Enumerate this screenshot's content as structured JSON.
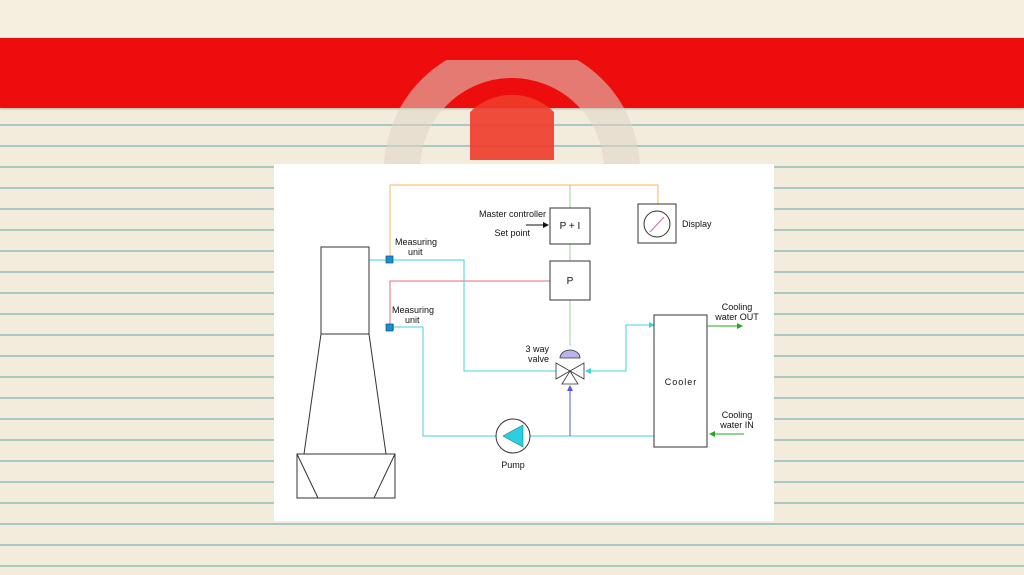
{
  "diagram": {
    "labels": {
      "measuring_unit_top_1": "Measuring",
      "measuring_unit_top_2": "unit",
      "measuring_unit_bottom_1": "Measuring",
      "measuring_unit_bottom_2": "unit",
      "master_controller": "Master controller",
      "set_point": "Set point",
      "pi_controller": "P + I",
      "p_controller": "P",
      "display": "Display",
      "valve_1": "3 way",
      "valve_2": "valve",
      "cooler": "Cooler",
      "cooling_out_1": "Cooling",
      "cooling_out_2": "water OUT",
      "cooling_in_1": "Cooling",
      "cooling_in_2": "water IN",
      "pump": "Pump"
    },
    "colors": {
      "water_line": "#3fd3e0",
      "signal_orange": "#f0b860",
      "signal_red": "#e07070",
      "signal_green": "#9ed09e",
      "cooling_water": "#22aa22",
      "bypass_blue": "#5555dd",
      "sensor": "#1a8fcf",
      "pump_fill": "#2ad0e0",
      "valve_fill": "#b9b2ee",
      "banner_red": "#ee0d0d"
    }
  }
}
